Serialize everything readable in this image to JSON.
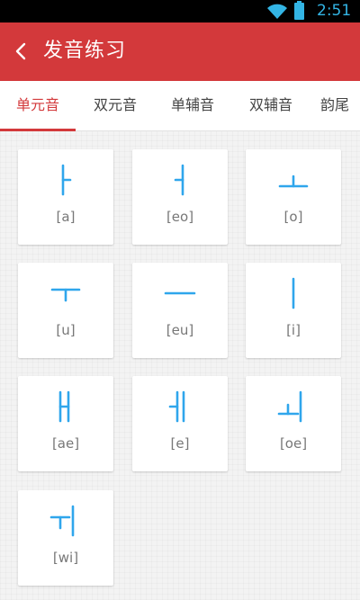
{
  "status_bar": {
    "time": "2:51",
    "icons": [
      "wifi-icon",
      "battery-icon"
    ]
  },
  "header": {
    "title": "发音练习",
    "back_icon": "chevron-left-icon"
  },
  "tabs": [
    {
      "label": "单元音",
      "active": true
    },
    {
      "label": "双元音",
      "active": false
    },
    {
      "label": "单辅音",
      "active": false
    },
    {
      "label": "双辅音",
      "active": false
    },
    {
      "label": "韵尾",
      "active": false
    }
  ],
  "vowels": [
    {
      "letter": "ㅏ",
      "romanization": "[a]"
    },
    {
      "letter": "ㅓ",
      "romanization": "[eo]"
    },
    {
      "letter": "ㅗ",
      "romanization": "[o]"
    },
    {
      "letter": "ㅜ",
      "romanization": "[u]"
    },
    {
      "letter": "ㅡ",
      "romanization": "[eu]"
    },
    {
      "letter": "ㅣ",
      "romanization": "[i]"
    },
    {
      "letter": "ㅐ",
      "romanization": "[ae]"
    },
    {
      "letter": "ㅔ",
      "romanization": "[e]"
    },
    {
      "letter": "ㅚ",
      "romanization": "[oe]"
    },
    {
      "letter": "ㅟ",
      "romanization": "[wi]"
    }
  ],
  "colors": {
    "accent": "#d3393b",
    "glyph": "#2fa6ec",
    "status": "#33b5e5"
  }
}
